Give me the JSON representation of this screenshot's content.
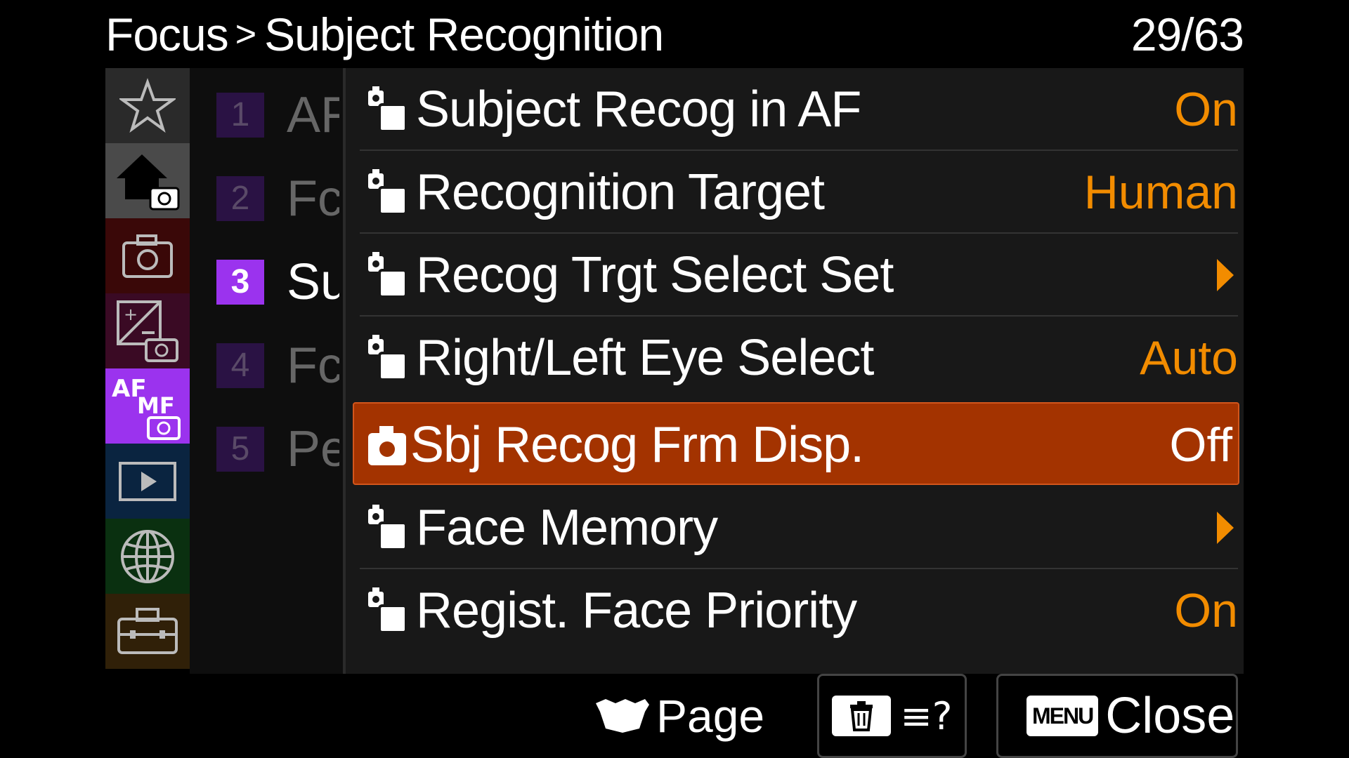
{
  "header": {
    "breadcrumb_parent": "Focus",
    "breadcrumb_separator": ">",
    "breadcrumb_current": "Subject Recognition",
    "page_counter": "29/63"
  },
  "tabs": [
    {
      "name": "My Menu",
      "icon": "star-icon",
      "color": "#2a2a2a"
    },
    {
      "name": "Main",
      "icon": "home-camera-icon",
      "color": "#4a4a4a",
      "selected": true
    },
    {
      "name": "Shooting",
      "icon": "camera-icon",
      "color": "#3a0808"
    },
    {
      "name": "Exposure/Color",
      "icon": "exposure-camera-icon",
      "color": "#3a0a24"
    },
    {
      "name": "Focus",
      "icon": "af-mf-camera-icon",
      "color": "#9b33ee",
      "active": true
    },
    {
      "name": "Playback",
      "icon": "play-icon",
      "color": "#0a2440"
    },
    {
      "name": "Network",
      "icon": "globe-icon",
      "color": "#0a3010"
    },
    {
      "name": "Setup",
      "icon": "toolbox-icon",
      "color": "#302008"
    }
  ],
  "pages": [
    {
      "num": "1",
      "label": "AF"
    },
    {
      "num": "2",
      "label": "Fc"
    },
    {
      "num": "3",
      "label": "Su",
      "active": true
    },
    {
      "num": "4",
      "label": "Fc"
    },
    {
      "num": "5",
      "label": "Pe"
    }
  ],
  "settings": [
    {
      "label": "Subject Recog in AF",
      "value": "On",
      "icon": "still-movie-icon"
    },
    {
      "label": "Recognition Target",
      "value": "Human",
      "icon": "still-movie-icon"
    },
    {
      "label": "Recog Trgt Select Set",
      "value": "",
      "icon": "still-movie-icon",
      "submenu": true
    },
    {
      "label": "Right/Left Eye Select",
      "value": "Auto",
      "icon": "still-movie-icon"
    },
    {
      "label": "Sbj Recog Frm Disp.",
      "value": "Off",
      "icon": "camera-icon",
      "selected": true
    },
    {
      "label": "Face Memory",
      "value": "",
      "icon": "still-movie-icon",
      "submenu": true
    },
    {
      "label": "Regist. Face Priority",
      "value": "On",
      "icon": "still-movie-icon"
    }
  ],
  "footer": {
    "page_label": "Page",
    "close_label": "Close",
    "menu_badge": "MENU",
    "help_glyph": "≡?"
  },
  "colors": {
    "accent_value": "#f28c00",
    "selection": "#a33300",
    "focus_tab": "#9b33ee"
  }
}
